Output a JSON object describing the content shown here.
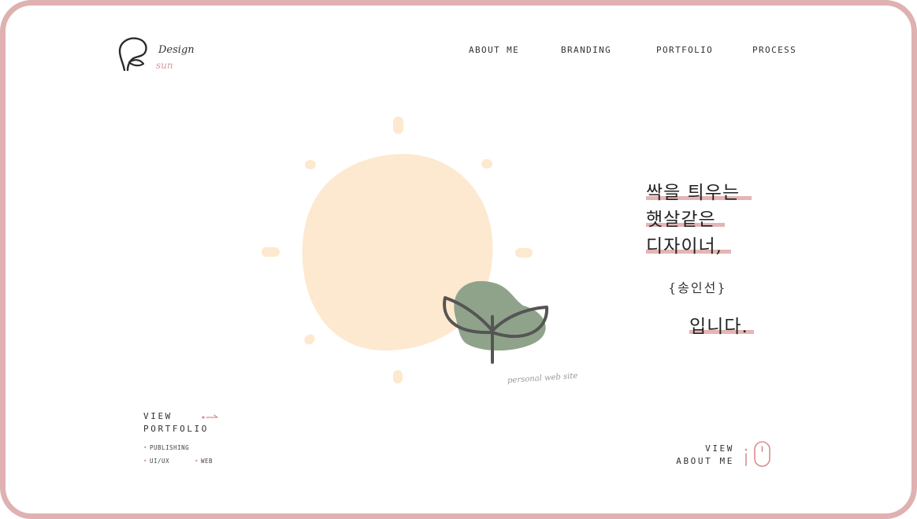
{
  "logo": {
    "line1": "Design",
    "line2": "sun"
  },
  "nav": [
    {
      "label": "ABOUT ME"
    },
    {
      "label": "BRANDING"
    },
    {
      "label": "PORTFOLIO"
    },
    {
      "label": "PROCESS"
    }
  ],
  "hero": {
    "caption": "personal web site"
  },
  "headline": {
    "line1": "싹을 틔우는",
    "line2": "햇살같은",
    "line3": "디자이너,",
    "name": "{송인선}",
    "line4": "입니다."
  },
  "view_portfolio": {
    "line1": "VIEW",
    "line2": "PORTFOLIO",
    "tags": [
      "PUBLISHING",
      "UI/UX",
      "WEB"
    ]
  },
  "view_about": {
    "line1": "VIEW",
    "line2": "ABOUT ME"
  },
  "colors": {
    "frame": "#dfb1b1",
    "sun": "#fde9cf",
    "leaf": "#8fa38b",
    "accent": "#e3b5b5"
  }
}
